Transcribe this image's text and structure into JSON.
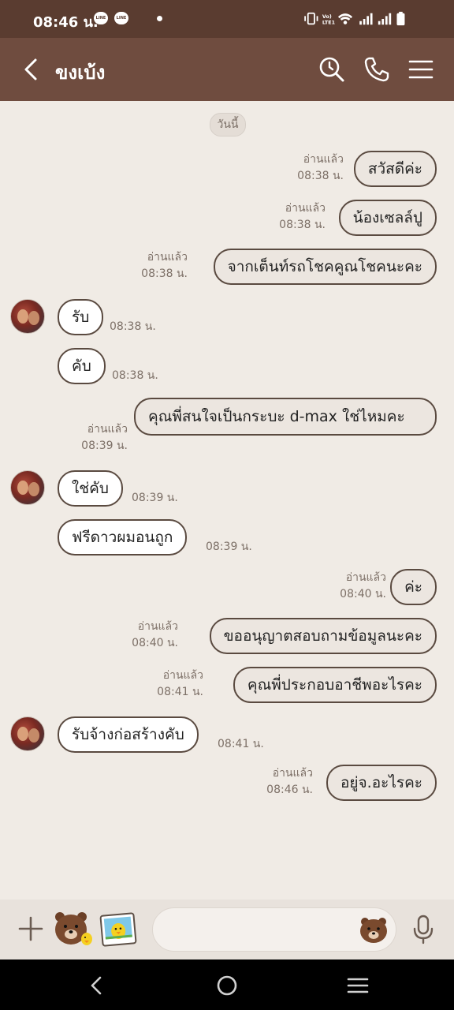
{
  "status_bar": {
    "time": "08:46 น.",
    "app_badge": "LINE",
    "volte_label": "Vo) LTE1"
  },
  "header": {
    "title": "ขงเบ้ง"
  },
  "chat": {
    "date_chip": "วันนี้",
    "read_label": "อ่านแล้ว",
    "messages": [
      {
        "dir": "out",
        "text": "สวัสดีค่ะ",
        "time": "08:38 น."
      },
      {
        "dir": "out",
        "text": "น้องเซลล์ปู",
        "time": "08:38 น."
      },
      {
        "dir": "out",
        "text": "จากเต็นท์รถโชคคูณโชคนะคะ",
        "time": "08:38 น."
      },
      {
        "dir": "in",
        "text": "รับ",
        "time": "08:38 น."
      },
      {
        "dir": "in",
        "text": "คับ",
        "time": "08:38 น."
      },
      {
        "dir": "out",
        "text": "คุณพี่สนใจเป็นกระบะ d-max ใช่ไหมคะ",
        "time": "08:39 น."
      },
      {
        "dir": "in",
        "text": "ใช่คับ",
        "time": "08:39 น."
      },
      {
        "dir": "in",
        "text": "ฟรีดาวผมอนถูก",
        "time": "08:39 น."
      },
      {
        "dir": "out",
        "text": "ค่ะ",
        "time": "08:40 น."
      },
      {
        "dir": "out",
        "text": "ขออนุญาตสอบถามข้อมูลนะคะ",
        "time": "08:40 น."
      },
      {
        "dir": "out",
        "text": "คุณพี่ประกอบอาชีพอะไรคะ",
        "time": "08:41 น."
      },
      {
        "dir": "in",
        "text": "รับจ้างก่อสร้างคับ",
        "time": "08:41 น."
      },
      {
        "dir": "out",
        "text": "อยู่จ.อะไรคะ",
        "time": "08:46 น."
      }
    ]
  },
  "input_bar": {
    "placeholder": ""
  },
  "colors": {
    "header_bg": "#6f4c3f",
    "status_bg": "#5a3c30",
    "chat_bg": "#f0ebe5",
    "bubble_border": "#5a4a40"
  },
  "icons": {
    "back": "chevron-left-icon",
    "search": "search-history-icon",
    "call": "phone-icon",
    "menu": "hamburger-menu-icon",
    "plus": "plus-icon",
    "sticker": "bear-sticker-icon",
    "photo": "photo-icon",
    "emoji": "bear-emoji-icon",
    "mic": "microphone-icon"
  }
}
